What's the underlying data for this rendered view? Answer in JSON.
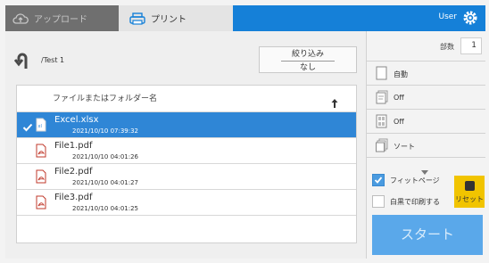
{
  "tabs": {
    "upload_label": "アップロード",
    "print_label": "プリント"
  },
  "header": {
    "user_label": "User"
  },
  "toolbar": {
    "path": "/Test 1",
    "filter_line1": "絞り込み",
    "filter_line2": "なし"
  },
  "list": {
    "header_label": "ファイルまたはフォルダー名",
    "rows": [
      {
        "name": "Excel.xlsx",
        "date": "2021/10/10 07:39:32",
        "selected": true
      },
      {
        "name": "File1.pdf",
        "date": "2021/10/10 04:01:26",
        "selected": false
      },
      {
        "name": "File2.pdf",
        "date": "2021/10/10 04:01:27",
        "selected": false
      },
      {
        "name": "File3.pdf",
        "date": "2021/10/10 04:01:25",
        "selected": false
      }
    ]
  },
  "settings": {
    "copies_label": "部数",
    "copies_value": "1",
    "options": [
      {
        "icon": "page-icon",
        "label": "自動"
      },
      {
        "icon": "duplex-icon",
        "label": "Off"
      },
      {
        "icon": "multi-page-icon",
        "label": "Off"
      },
      {
        "icon": "sort-icon",
        "label": "ソート"
      }
    ],
    "fit_page_label": "フィットページ",
    "fit_page_checked": true,
    "blank_print_label": "白黒で印刷する",
    "blank_print_checked": false,
    "reset_label": "リセット",
    "start_label": "スタート"
  },
  "colors": {
    "accent": "#1580d8",
    "selection": "#2f86d6",
    "reset": "#f1c400",
    "start": "#5aa8ea"
  }
}
